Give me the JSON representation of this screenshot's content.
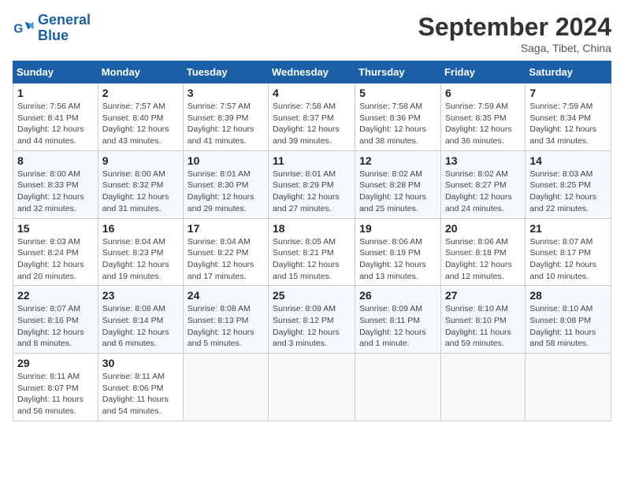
{
  "logo": {
    "line1": "General",
    "line2": "Blue"
  },
  "title": "September 2024",
  "subtitle": "Saga, Tibet, China",
  "days_of_week": [
    "Sunday",
    "Monday",
    "Tuesday",
    "Wednesday",
    "Thursday",
    "Friday",
    "Saturday"
  ],
  "weeks": [
    [
      {
        "day": "1",
        "info": "Sunrise: 7:56 AM\nSunset: 8:41 PM\nDaylight: 12 hours\nand 44 minutes."
      },
      {
        "day": "2",
        "info": "Sunrise: 7:57 AM\nSunset: 8:40 PM\nDaylight: 12 hours\nand 43 minutes."
      },
      {
        "day": "3",
        "info": "Sunrise: 7:57 AM\nSunset: 8:39 PM\nDaylight: 12 hours\nand 41 minutes."
      },
      {
        "day": "4",
        "info": "Sunrise: 7:58 AM\nSunset: 8:37 PM\nDaylight: 12 hours\nand 39 minutes."
      },
      {
        "day": "5",
        "info": "Sunrise: 7:58 AM\nSunset: 8:36 PM\nDaylight: 12 hours\nand 38 minutes."
      },
      {
        "day": "6",
        "info": "Sunrise: 7:59 AM\nSunset: 8:35 PM\nDaylight: 12 hours\nand 36 minutes."
      },
      {
        "day": "7",
        "info": "Sunrise: 7:59 AM\nSunset: 8:34 PM\nDaylight: 12 hours\nand 34 minutes."
      }
    ],
    [
      {
        "day": "8",
        "info": "Sunrise: 8:00 AM\nSunset: 8:33 PM\nDaylight: 12 hours\nand 32 minutes."
      },
      {
        "day": "9",
        "info": "Sunrise: 8:00 AM\nSunset: 8:32 PM\nDaylight: 12 hours\nand 31 minutes."
      },
      {
        "day": "10",
        "info": "Sunrise: 8:01 AM\nSunset: 8:30 PM\nDaylight: 12 hours\nand 29 minutes."
      },
      {
        "day": "11",
        "info": "Sunrise: 8:01 AM\nSunset: 8:29 PM\nDaylight: 12 hours\nand 27 minutes."
      },
      {
        "day": "12",
        "info": "Sunrise: 8:02 AM\nSunset: 8:28 PM\nDaylight: 12 hours\nand 25 minutes."
      },
      {
        "day": "13",
        "info": "Sunrise: 8:02 AM\nSunset: 8:27 PM\nDaylight: 12 hours\nand 24 minutes."
      },
      {
        "day": "14",
        "info": "Sunrise: 8:03 AM\nSunset: 8:25 PM\nDaylight: 12 hours\nand 22 minutes."
      }
    ],
    [
      {
        "day": "15",
        "info": "Sunrise: 8:03 AM\nSunset: 8:24 PM\nDaylight: 12 hours\nand 20 minutes."
      },
      {
        "day": "16",
        "info": "Sunrise: 8:04 AM\nSunset: 8:23 PM\nDaylight: 12 hours\nand 19 minutes."
      },
      {
        "day": "17",
        "info": "Sunrise: 8:04 AM\nSunset: 8:22 PM\nDaylight: 12 hours\nand 17 minutes."
      },
      {
        "day": "18",
        "info": "Sunrise: 8:05 AM\nSunset: 8:21 PM\nDaylight: 12 hours\nand 15 minutes."
      },
      {
        "day": "19",
        "info": "Sunrise: 8:06 AM\nSunset: 8:19 PM\nDaylight: 12 hours\nand 13 minutes."
      },
      {
        "day": "20",
        "info": "Sunrise: 8:06 AM\nSunset: 8:18 PM\nDaylight: 12 hours\nand 12 minutes."
      },
      {
        "day": "21",
        "info": "Sunrise: 8:07 AM\nSunset: 8:17 PM\nDaylight: 12 hours\nand 10 minutes."
      }
    ],
    [
      {
        "day": "22",
        "info": "Sunrise: 8:07 AM\nSunset: 8:16 PM\nDaylight: 12 hours\nand 8 minutes."
      },
      {
        "day": "23",
        "info": "Sunrise: 8:08 AM\nSunset: 8:14 PM\nDaylight: 12 hours\nand 6 minutes."
      },
      {
        "day": "24",
        "info": "Sunrise: 8:08 AM\nSunset: 8:13 PM\nDaylight: 12 hours\nand 5 minutes."
      },
      {
        "day": "25",
        "info": "Sunrise: 8:09 AM\nSunset: 8:12 PM\nDaylight: 12 hours\nand 3 minutes."
      },
      {
        "day": "26",
        "info": "Sunrise: 8:09 AM\nSunset: 8:11 PM\nDaylight: 12 hours\nand 1 minute."
      },
      {
        "day": "27",
        "info": "Sunrise: 8:10 AM\nSunset: 8:10 PM\nDaylight: 11 hours\nand 59 minutes."
      },
      {
        "day": "28",
        "info": "Sunrise: 8:10 AM\nSunset: 8:08 PM\nDaylight: 11 hours\nand 58 minutes."
      }
    ],
    [
      {
        "day": "29",
        "info": "Sunrise: 8:11 AM\nSunset: 8:07 PM\nDaylight: 11 hours\nand 56 minutes."
      },
      {
        "day": "30",
        "info": "Sunrise: 8:11 AM\nSunset: 8:06 PM\nDaylight: 11 hours\nand 54 minutes."
      },
      {
        "day": "",
        "info": ""
      },
      {
        "day": "",
        "info": ""
      },
      {
        "day": "",
        "info": ""
      },
      {
        "day": "",
        "info": ""
      },
      {
        "day": "",
        "info": ""
      }
    ]
  ]
}
